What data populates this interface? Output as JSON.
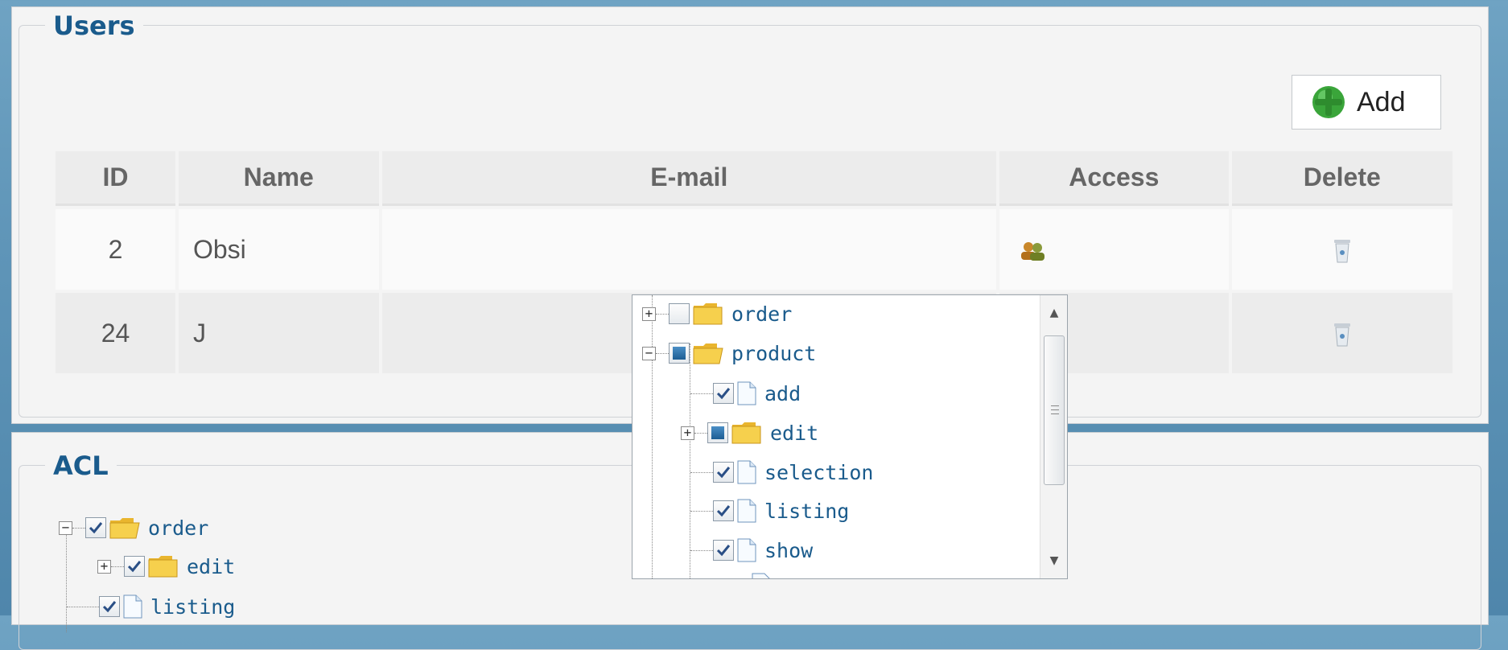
{
  "users_section": {
    "title": "Users",
    "add_label": "Add",
    "columns": [
      "ID",
      "Name",
      "E-mail",
      "Access",
      "Delete"
    ],
    "rows": [
      {
        "id": "2",
        "name": "Obsi",
        "email": ""
      },
      {
        "id": "24",
        "name": "J",
        "email": ""
      }
    ]
  },
  "acl_section": {
    "title": "ACL",
    "tree": [
      {
        "label": "order",
        "expander": "−",
        "checkbox": "checked",
        "kind": "folder-open"
      },
      {
        "label": "edit",
        "expander": "+",
        "checkbox": "checked",
        "kind": "folder"
      },
      {
        "label": "listing",
        "expander": "",
        "checkbox": "checked",
        "kind": "file"
      }
    ]
  },
  "access_popup": {
    "tree": [
      {
        "label": "order",
        "expander": "+",
        "checkbox": "unchecked",
        "kind": "folder"
      },
      {
        "label": "product",
        "expander": "−",
        "checkbox": "partial",
        "kind": "folder-open"
      },
      {
        "label": "add",
        "expander": "",
        "checkbox": "checked",
        "kind": "file"
      },
      {
        "label": "edit",
        "expander": "+",
        "checkbox": "partial",
        "kind": "folder"
      },
      {
        "label": "selection",
        "expander": "",
        "checkbox": "checked",
        "kind": "file"
      },
      {
        "label": "listing",
        "expander": "",
        "checkbox": "checked",
        "kind": "file"
      },
      {
        "label": "show",
        "expander": "",
        "checkbox": "checked",
        "kind": "file"
      }
    ]
  },
  "colors": {
    "title_blue": "#1a5b8c",
    "tree_text": "#1a5b8c",
    "folder_yellow": "#f6d04d",
    "add_green": "#3aa53a"
  }
}
